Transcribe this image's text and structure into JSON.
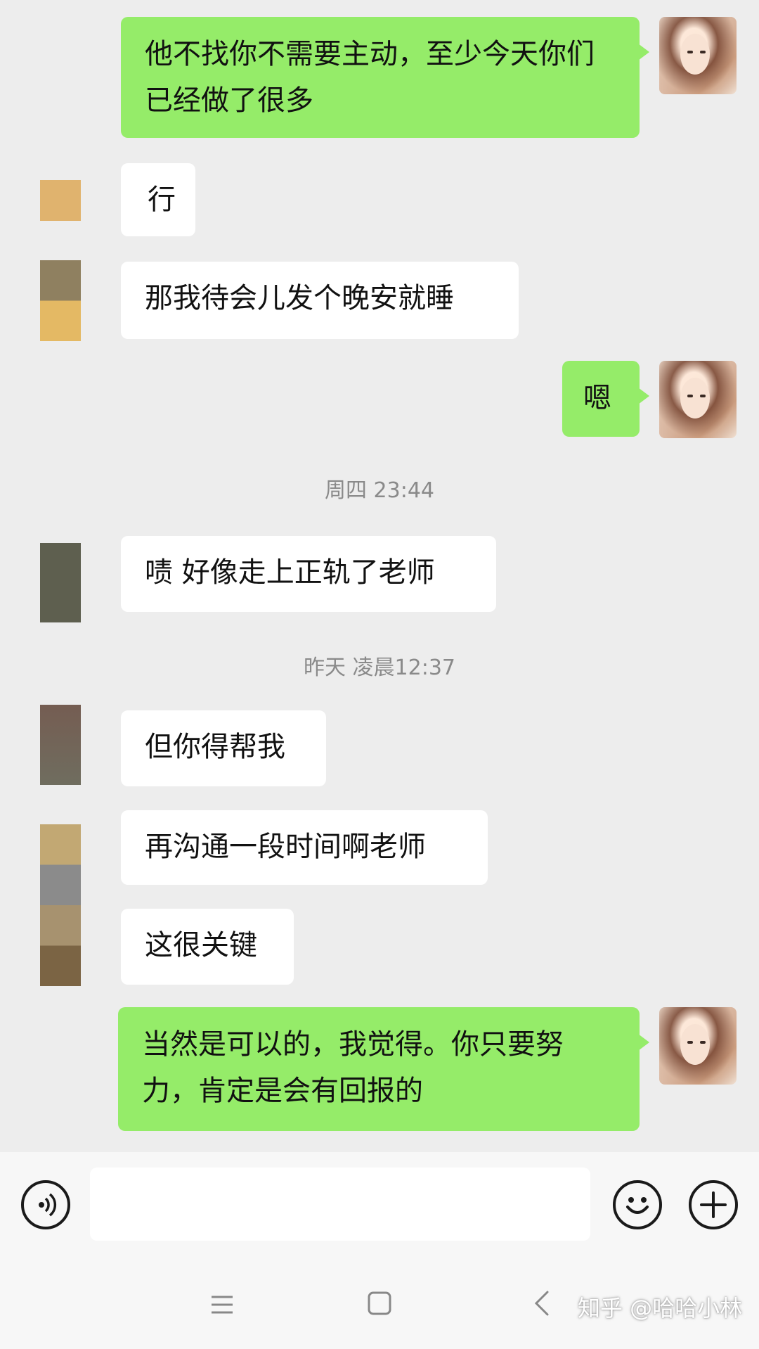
{
  "messages": [
    {
      "text": "他不找你不需要主动，至少今天你们已经做了很多"
    },
    {
      "text": "行"
    },
    {
      "text": "那我待会儿发个晚安就睡"
    },
    {
      "text": "嗯"
    },
    {
      "text": "啧 好像走上正轨了老师"
    },
    {
      "text": "但你得帮我"
    },
    {
      "text": "再沟通一段时间啊老师"
    },
    {
      "text": "这很关键"
    },
    {
      "text": "当然是可以的，我觉得。你只要努力，肯定是会有回报的"
    }
  ],
  "timestamps": [
    "周四 23:44",
    "昨天 凌晨12:37"
  ],
  "input_bar": {
    "voice_icon": "voice-icon",
    "emoji_icon": "emoji-icon",
    "plus_icon": "plus-icon"
  },
  "navbar": {
    "menu_icon": "menu-icon",
    "home_icon": "home-icon",
    "back_icon": "back-icon"
  },
  "watermark": "知乎 @哈哈小林",
  "colors": {
    "background": "#ededed",
    "sent_bubble": "#95ec69",
    "received_bubble": "#ffffff",
    "timestamp_text": "#8a8a8a"
  }
}
